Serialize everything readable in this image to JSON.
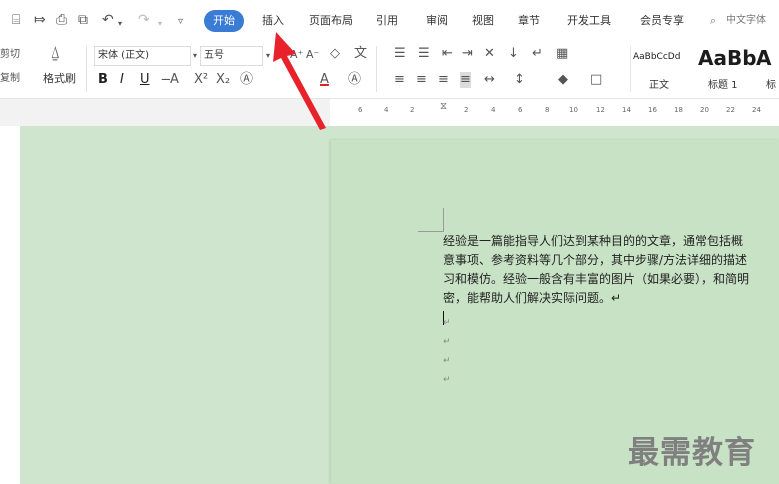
{
  "menubar": {
    "quick_icons": [
      "⌸",
      "⤇",
      "⎙",
      "⧉",
      "↶",
      "↷",
      "▿"
    ],
    "active_tab": "开始",
    "tabs": [
      "插入",
      "页面布局",
      "引用",
      "审阅",
      "视图",
      "章节",
      "开发工具",
      "会员专享"
    ],
    "search_label": "中文字体"
  },
  "ribbon": {
    "cut_label": "剪切",
    "copy_label": "复制",
    "format_painter_label": "格式刷",
    "font_name": "宋体 (正文)",
    "font_size": "五号",
    "bold": "B",
    "italic": "I",
    "underline": "U",
    "styles": [
      {
        "preview": "AaBbCcDd",
        "label": "正文"
      },
      {
        "preview": "AaBb",
        "label": "标题 1"
      },
      {
        "preview": "A",
        "label": "标"
      }
    ]
  },
  "ruler": {
    "numbers": [
      "6",
      "4",
      "2",
      "2",
      "4",
      "6",
      "8",
      "10",
      "12",
      "14",
      "16",
      "18",
      "20",
      "22",
      "24"
    ]
  },
  "document": {
    "lines": [
      "经验是一篇能指导人们达到某种目的的文章，通常包括概",
      "意事项、参考资料等几个部分，其中步骤/方法详细的描述",
      "习和模仿。经验一般含有丰富的图片（如果必要），和简明",
      "密，能帮助人们解决实际问题。↵"
    ],
    "paragraph_mark": "↵"
  },
  "watermark": "最需教育",
  "colors": {
    "active_tab": "#3a7bd5",
    "page_background": "#c8e2c5",
    "arrow": "#e8222a"
  }
}
